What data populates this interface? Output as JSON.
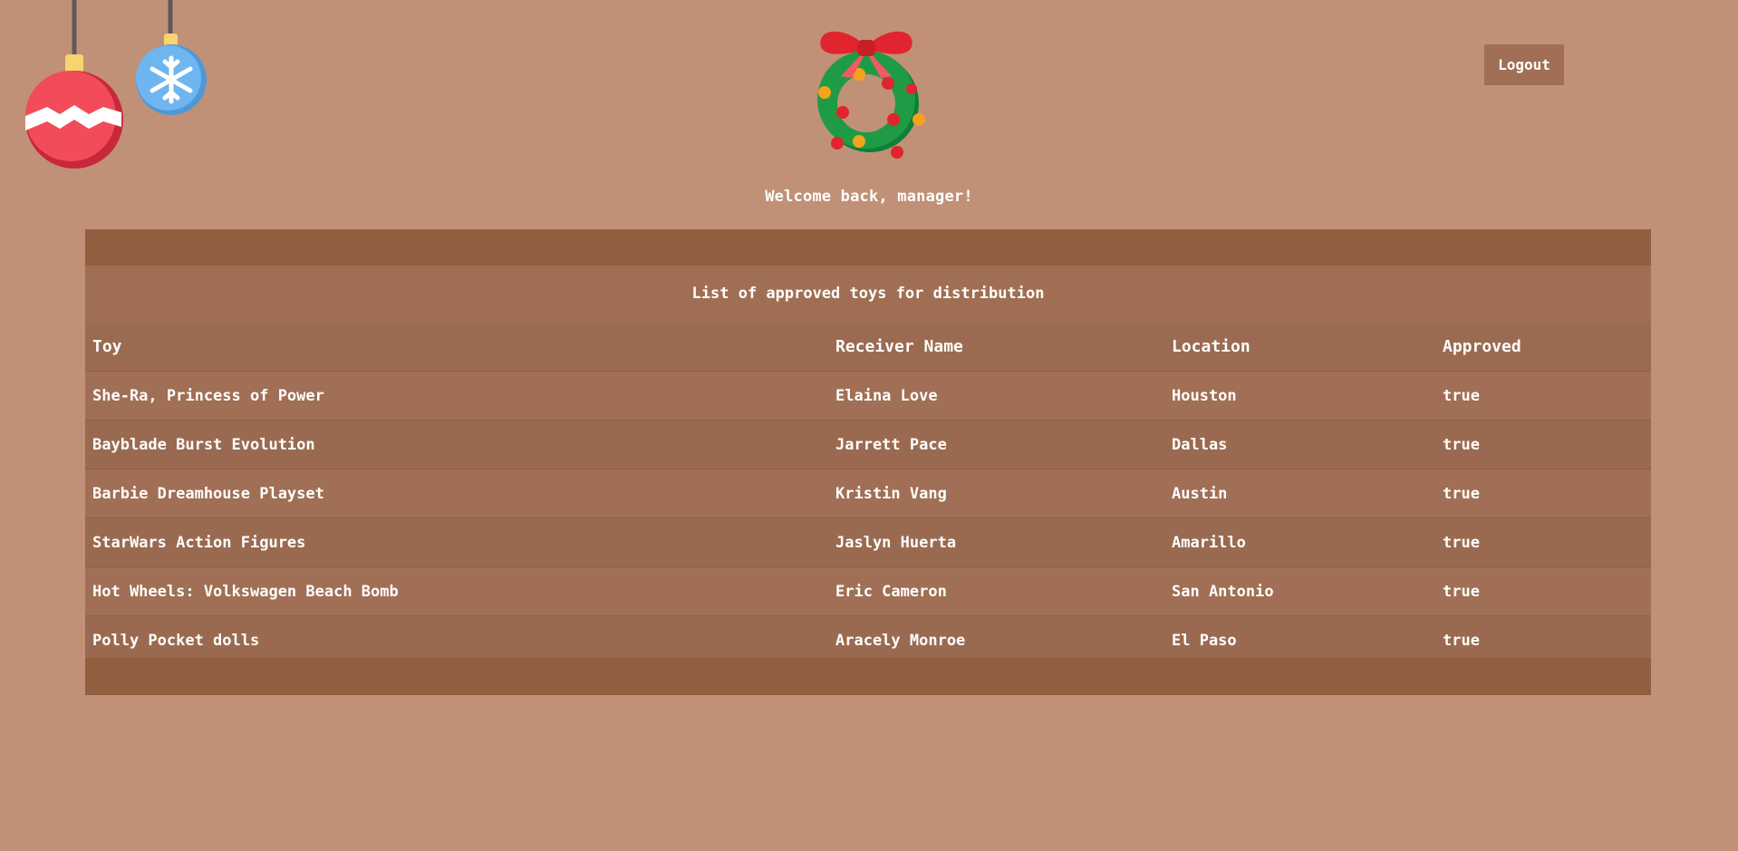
{
  "header": {
    "logout_label": "Logout",
    "welcome_text": "Welcome back, manager!"
  },
  "decorations": {
    "ornament_left_icon": "red-ornament-icon",
    "ornament_right_icon": "snowflake-ornament-icon",
    "logo_icon": "wreath-icon",
    "colors": {
      "background": "#c09177",
      "panel_dark": "#915f3f",
      "panel": "#a06f55",
      "ornament_red": "#f24b59",
      "ornament_blue": "#6fb5ef",
      "wreath_green": "#1f9b45",
      "bow_red": "#e0252f"
    }
  },
  "table": {
    "caption": "List of approved toys for distribution",
    "headers": [
      "Toy",
      "Receiver Name",
      "Location",
      "Approved"
    ],
    "rows": [
      [
        "She-Ra, Princess of Power",
        "Elaina Love",
        "Houston",
        "true"
      ],
      [
        "Bayblade Burst Evolution",
        "Jarrett Pace",
        "Dallas",
        "true"
      ],
      [
        "Barbie Dreamhouse Playset",
        "Kristin Vang",
        "Austin",
        "true"
      ],
      [
        "StarWars Action Figures",
        "Jaslyn Huerta",
        "Amarillo",
        "true"
      ],
      [
        "Hot Wheels: Volkswagen Beach Bomb",
        "Eric Cameron",
        "San Antonio",
        "true"
      ],
      [
        "Polly Pocket dolls",
        "Aracely Monroe",
        "El Paso",
        "true"
      ]
    ]
  }
}
